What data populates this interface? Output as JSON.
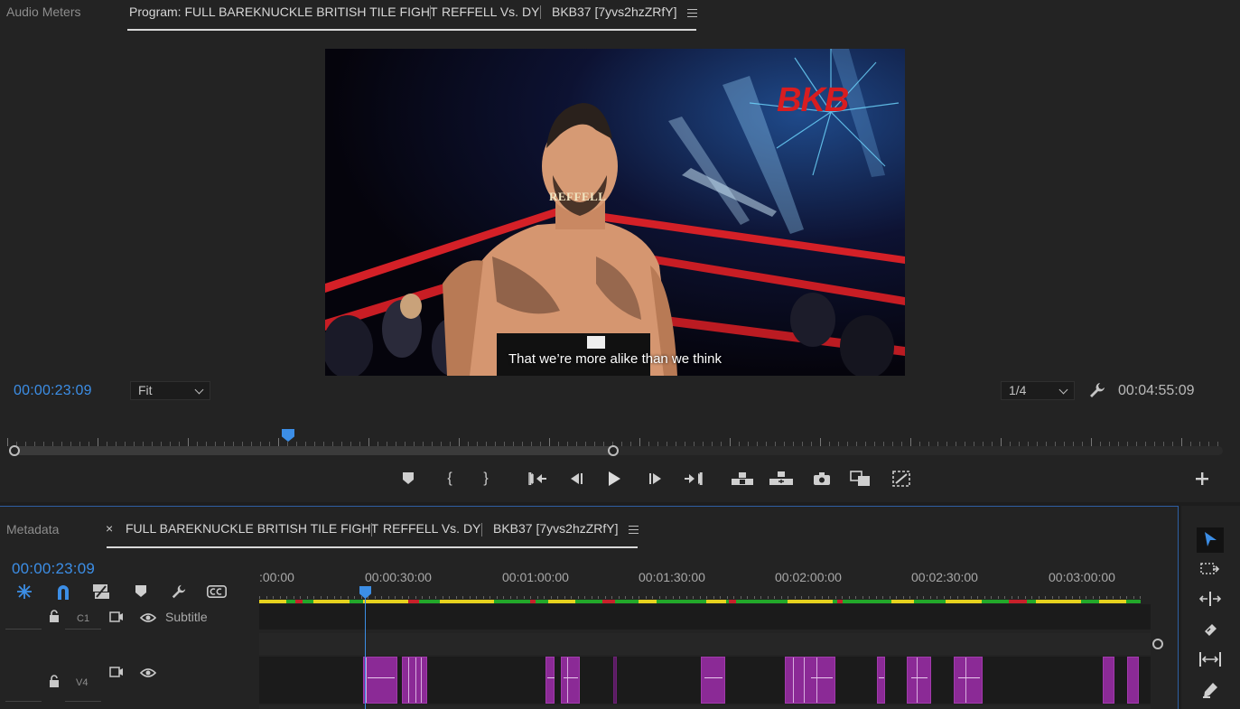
{
  "program_panel": {
    "tab_audio_meters": "Audio Meters",
    "tab_program_prefix": "Program: FULL BAREKNUCKLE BRITISH TILE FIGHT",
    "tab_seq2": "REFFELL Vs. DY",
    "tab_seq3": "BKB37 [7yvs2hzZRfY]",
    "current_timecode": "00:00:23:09",
    "zoom_select": "Fit",
    "resolution_select": "1/4",
    "duration_timecode": "00:04:55:09",
    "playhead_fraction": 0.23
  },
  "video": {
    "name_overlay": "REFFELL",
    "logo_text": "BKB",
    "caption": "That we’re more alike than we think"
  },
  "transport": {
    "icons": [
      "add-marker-icon",
      "mark-in-icon",
      "mark-out-icon",
      "go-to-in-icon",
      "step-back-icon",
      "play-icon",
      "step-forward-icon",
      "go-to-out-icon",
      "lift-icon",
      "extract-icon",
      "export-frame-icon",
      "comparison-view-icon",
      "proxy-toggle-icon",
      "add-button-icon"
    ]
  },
  "timeline_panel": {
    "tab_metadata": "Metadata",
    "tab_close": "×",
    "tab_seq1": "FULL BAREKNUCKLE BRITISH TILE FIGHT",
    "tab_seq2": "REFFELL Vs. DY",
    "tab_seq3": "BKB37 [7yvs2hzZRfY]",
    "current_timecode": "00:00:23:09",
    "ruler_labels": [
      ":00:00",
      "00:00:30:00",
      "00:01:00:00",
      "00:01:30:00",
      "00:02:00:00",
      "00:02:30:00",
      "00:03:00:00"
    ],
    "tracks": {
      "c1": {
        "label": "C1",
        "name": "Subtitle"
      },
      "v4": {
        "label": "V4"
      }
    }
  },
  "tools": {
    "items": [
      "selection-tool-icon",
      "track-select-tool-icon",
      "ripple-edit-tool-icon",
      "razor-tool-icon",
      "slip-tool-icon",
      "pen-tool-icon"
    ],
    "active": "selection-tool-icon"
  },
  "colors": {
    "accent_blue": "#3c8ee6",
    "clip_purple": "#8b2a96",
    "render_green": "#22a82a",
    "render_yellow": "#e6d21e",
    "render_red": "#c8202a"
  }
}
